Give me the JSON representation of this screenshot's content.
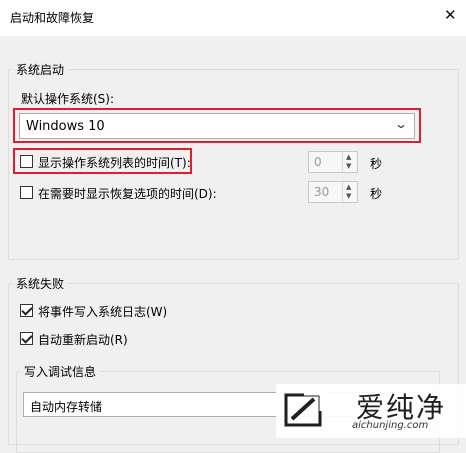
{
  "window": {
    "title": "启动和故障恢复",
    "close_glyph": "✕"
  },
  "system_startup": {
    "group_label": "系统启动",
    "default_os_label": "默认操作系统(S):",
    "default_os_value": "Windows 10",
    "show_list": {
      "label": "显示操作系统列表的时间(T):",
      "checked": false,
      "value": "0",
      "unit": "秒"
    },
    "show_recovery": {
      "label": "在需要时显示恢复选项的时间(D):",
      "checked": false,
      "value": "30",
      "unit": "秒"
    }
  },
  "system_failure": {
    "group_label": "系统失败",
    "write_event": {
      "label": "将事件写入系统日志(W)",
      "checked": true
    },
    "auto_restart": {
      "label": "自动重新启动(R)",
      "checked": true
    },
    "debug_group_label": "写入调试信息",
    "debug_value": "自动内存转储"
  },
  "watermark": {
    "name": "爱纯净",
    "url": "aichunjing.com"
  },
  "colors": {
    "highlight": "#d9202c",
    "background": "#f0f0f0"
  },
  "icons": {
    "dropdown": "chevron-down-icon",
    "spin_up": "caret-up-icon",
    "spin_down": "caret-down-icon"
  }
}
